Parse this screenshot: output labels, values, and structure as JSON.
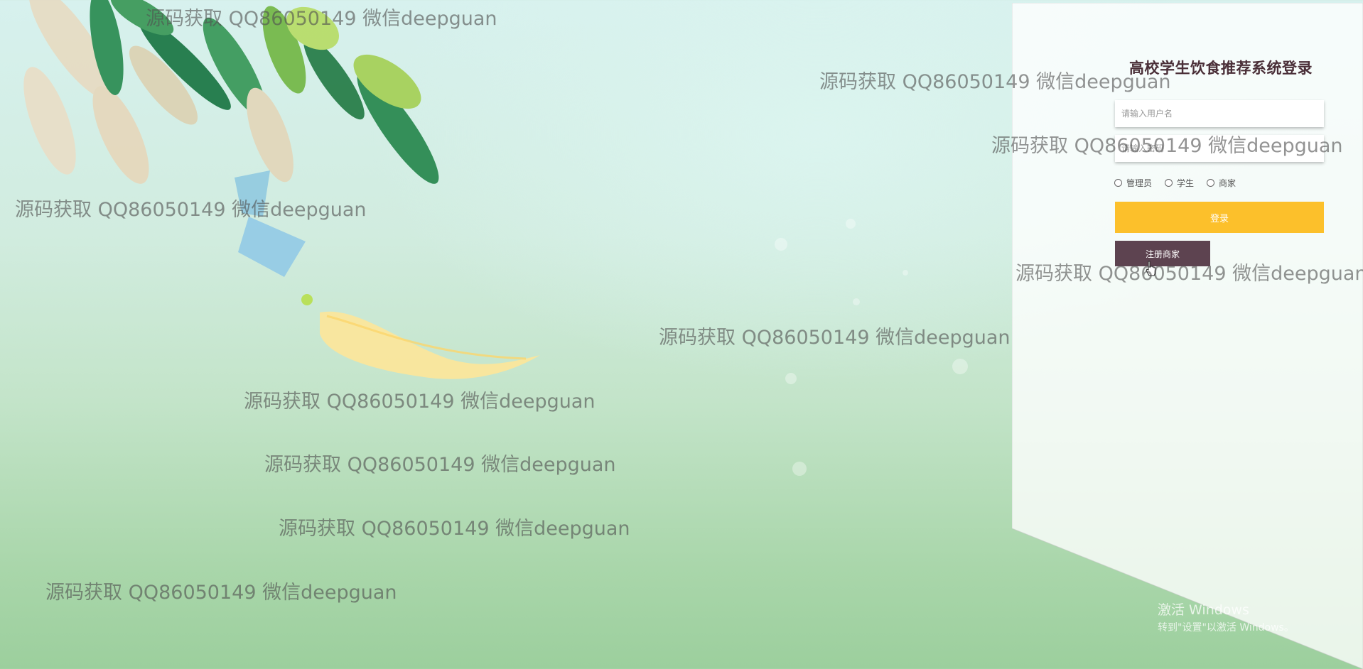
{
  "login": {
    "title": "高校学生饮食推荐系统登录",
    "username_placeholder": "请输入用户名",
    "password_placeholder": "请输入密码",
    "roles": [
      "管理员",
      "学生",
      "商家"
    ],
    "login_label": "登录",
    "register_label": "注册商家"
  },
  "watermark": {
    "text": "源码获取 QQ86050149 微信deepguan"
  },
  "windows_activation": {
    "line1": "激活 Windows",
    "line2": "转到\"设置\"以激活 Windows。"
  },
  "colors": {
    "login_button": "#fcc02b",
    "register_button": "#5d4350",
    "title": "#4a2f38"
  }
}
